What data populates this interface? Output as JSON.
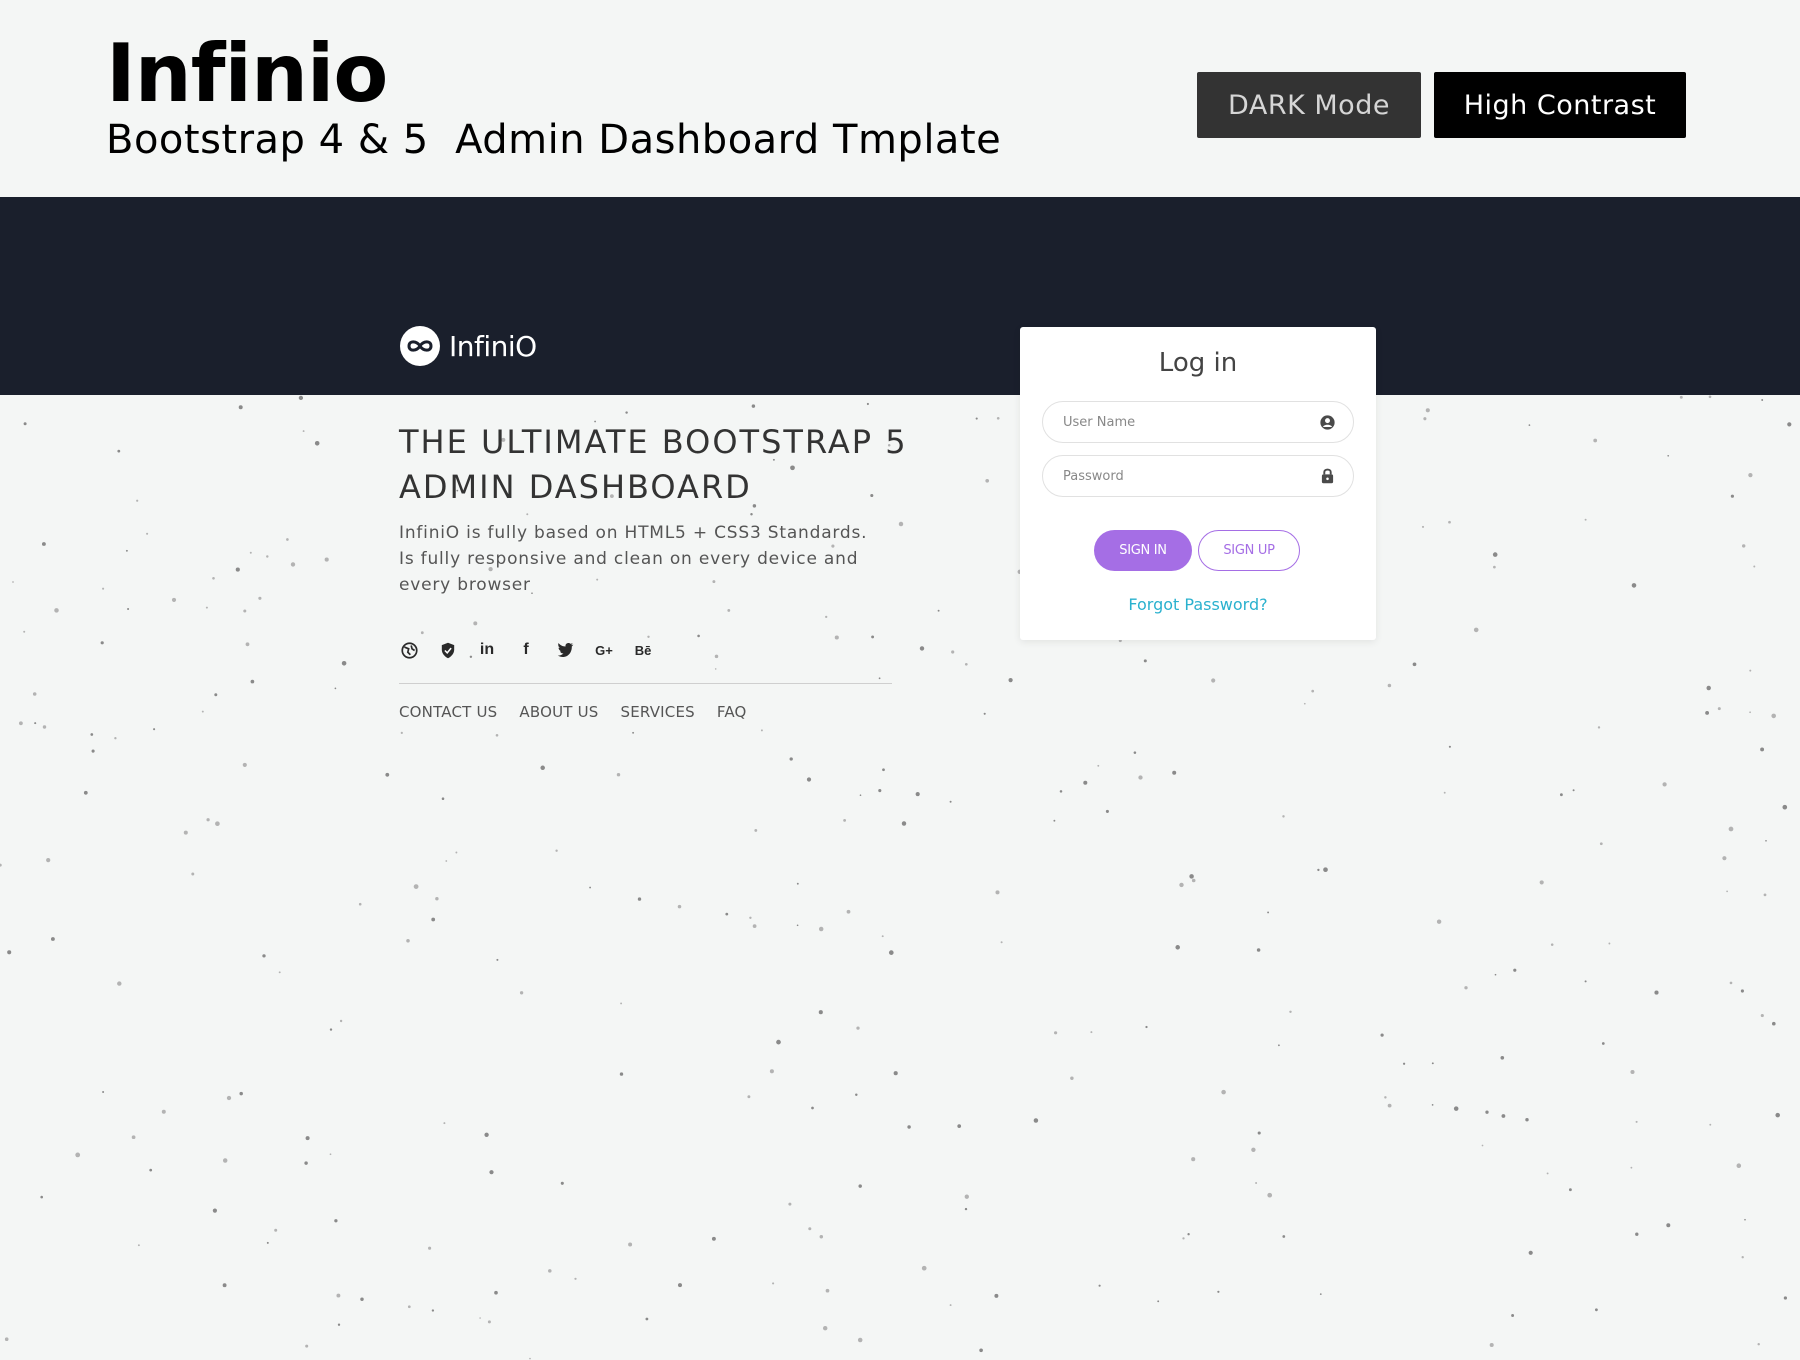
{
  "promo": {
    "title": "Infinio",
    "subtitle": "Bootstrap 4 & 5  Admin Dashboard Tmplate",
    "dark_mode_label": "DARK Mode",
    "high_contrast_label": "High Contrast"
  },
  "brand": {
    "name": "InfiniO",
    "logo_icon": "infinity-icon"
  },
  "hero": {
    "headline": "THE ULTIMATE BOOTSTRAP 5 ADMIN DASHBOARD",
    "description": "InfiniO is fully based on HTML5 + CSS3 Standards. Is fully responsive and clean on every device and every browser"
  },
  "socials": [
    {
      "icon": "globe-icon"
    },
    {
      "icon": "shield-icon"
    },
    {
      "icon": "linkedin-icon",
      "glyph": "in"
    },
    {
      "icon": "facebook-icon",
      "glyph": "f"
    },
    {
      "icon": "twitter-icon"
    },
    {
      "icon": "google-plus-icon",
      "glyph": "G+"
    },
    {
      "icon": "behance-icon",
      "glyph": "Bē"
    }
  ],
  "footer_links": [
    "CONTACT US",
    "ABOUT US",
    "SERVICES",
    "FAQ"
  ],
  "login": {
    "title": "Log in",
    "username_placeholder": "User Name",
    "password_placeholder": "Password",
    "sign_in_label": "SIGN IN",
    "sign_up_label": "SIGN UP",
    "forgot_label": "Forgot Password?"
  },
  "colors": {
    "accent": "#a56ee5",
    "link": "#2ab1ce",
    "navy": "#1a1f2c",
    "background": "#f4f6f5"
  }
}
